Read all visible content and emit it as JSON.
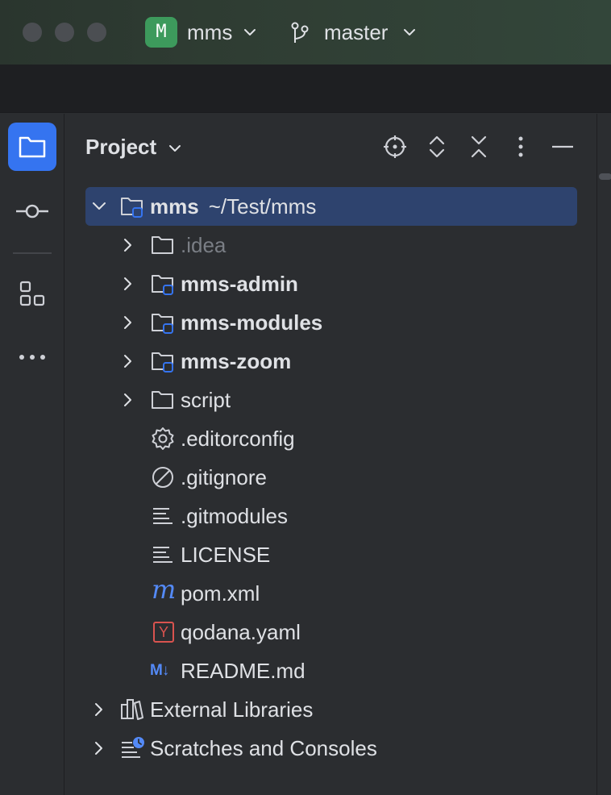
{
  "window": {
    "project_badge": "M",
    "project_name": "mms",
    "branch_name": "master"
  },
  "panel": {
    "title": "Project"
  },
  "tree": {
    "root": {
      "name": "mms",
      "path": "~/Test/mms"
    },
    "items": [
      {
        "label": ".idea",
        "kind": "folder",
        "expandable": true,
        "module": false,
        "dim": true
      },
      {
        "label": "mms-admin",
        "kind": "module-folder",
        "expandable": true,
        "module": true
      },
      {
        "label": "mms-modules",
        "kind": "module-folder",
        "expandable": true,
        "module": true
      },
      {
        "label": "mms-zoom",
        "kind": "module-folder",
        "expandable": true,
        "module": true
      },
      {
        "label": "script",
        "kind": "folder",
        "expandable": true,
        "module": false
      },
      {
        "label": ".editorconfig",
        "kind": "gear-file"
      },
      {
        "label": ".gitignore",
        "kind": "ignore-file"
      },
      {
        "label": ".gitmodules",
        "kind": "text-file"
      },
      {
        "label": "LICENSE",
        "kind": "text-file"
      },
      {
        "label": "pom.xml",
        "kind": "maven-file"
      },
      {
        "label": "qodana.yaml",
        "kind": "yaml-file"
      },
      {
        "label": "README.md",
        "kind": "markdown-file"
      }
    ],
    "external_libraries": "External Libraries",
    "scratches": "Scratches and Consoles",
    "icon_glyphs": {
      "maven": "m",
      "yaml": "Y",
      "markdown": "M↓"
    }
  },
  "colors": {
    "accent": "#3574f0",
    "selection": "#2e436e",
    "badge": "#3d9a5c",
    "yaml_red": "#d9534f"
  }
}
